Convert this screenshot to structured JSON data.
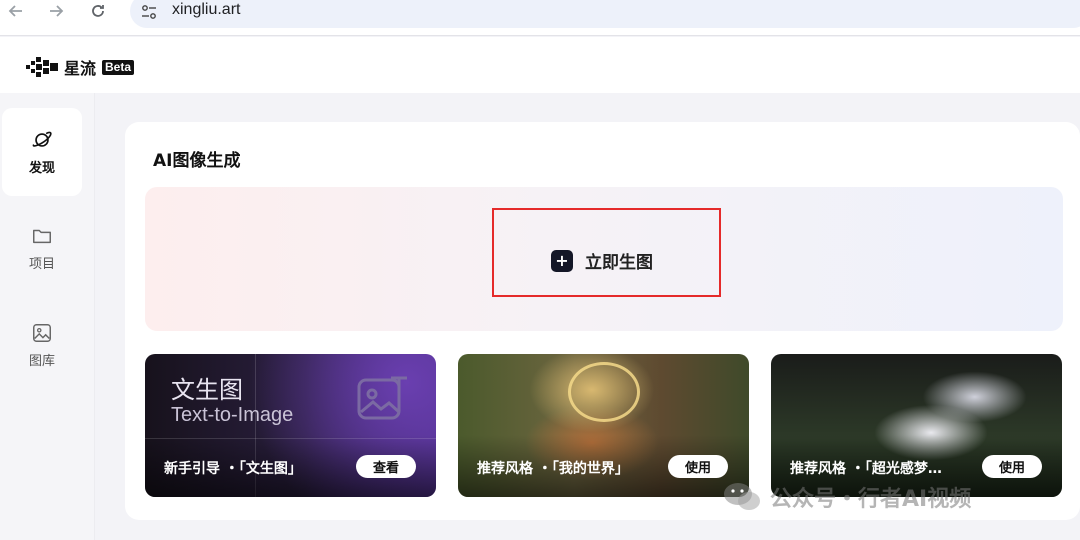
{
  "browser": {
    "url": "xingliu.art",
    "back_icon": "arrow-left-icon",
    "forward_icon": "arrow-right-icon",
    "reload_icon": "reload-icon",
    "site_icon": "tune-icon"
  },
  "header": {
    "logo_name": "星流",
    "logo_badge": "Beta"
  },
  "sidebar": {
    "items": [
      {
        "label": "发现",
        "icon": "planet-icon",
        "active": true
      },
      {
        "label": "项目",
        "icon": "folder-icon",
        "active": false
      },
      {
        "label": "图库",
        "icon": "image-icon",
        "active": false
      }
    ]
  },
  "main": {
    "section_title": "AI图像生成",
    "generate_label": "立即生图",
    "highlight_color": "#e52a2a",
    "cards": [
      {
        "title": "文生图",
        "subtitle": "Text-to-Image",
        "text": "新手引导 ・「文生图」",
        "button": "查看"
      },
      {
        "text": "推荐风格 ・「我的世界」",
        "button": "使用"
      },
      {
        "text": "推荐风格 ・「超光感梦…",
        "button": "使用"
      }
    ]
  },
  "watermark": {
    "text": "公众号・行者AI视频"
  }
}
